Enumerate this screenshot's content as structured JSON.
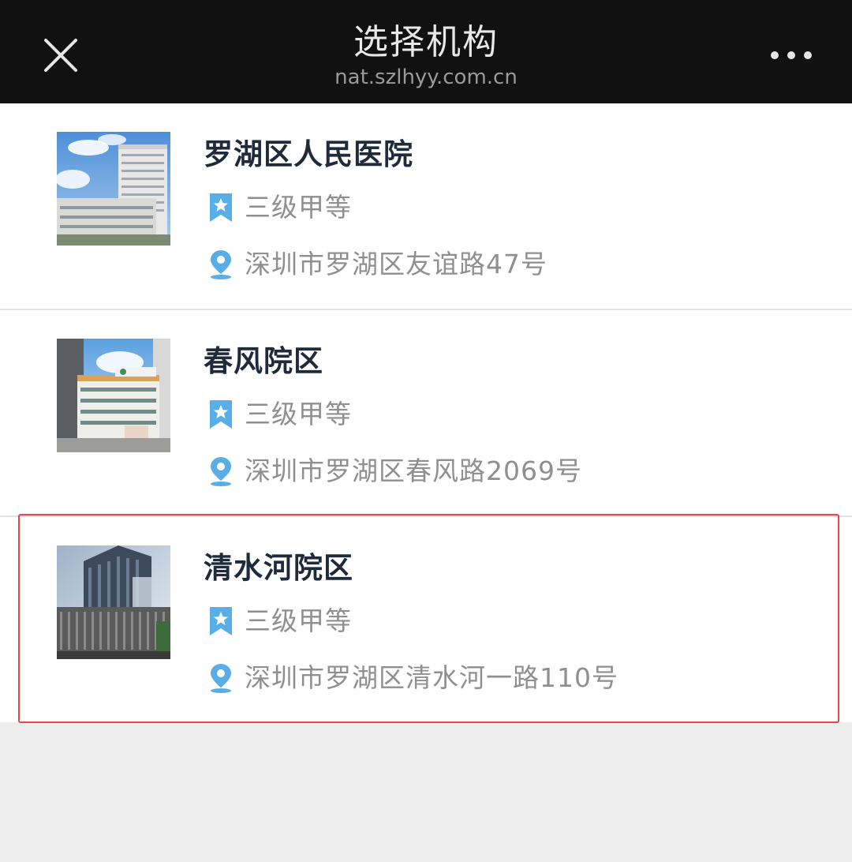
{
  "header": {
    "title": "选择机构",
    "url": "nat.szlhyy.com.cn",
    "close_icon": "close-icon",
    "more_icon": "more-icon"
  },
  "hospitals": [
    {
      "name": "罗湖区人民医院",
      "level": "三级甲等",
      "address": "深圳市罗湖区友谊路47号",
      "image": "hospital-building-photo"
    },
    {
      "name": "春风院区",
      "level": "三级甲等",
      "address": "深圳市罗湖区春风路2069号",
      "image": "hospital-building-photo"
    },
    {
      "name": "清水河院区",
      "level": "三级甲等",
      "address": "深圳市罗湖区清水河一路110号",
      "image": "hospital-building-photo",
      "highlighted": true
    }
  ],
  "colors": {
    "header_bg": "#111111",
    "icon_blue": "#5aaee6",
    "highlight_border": "#e54848",
    "page_bg": "#ededed"
  }
}
